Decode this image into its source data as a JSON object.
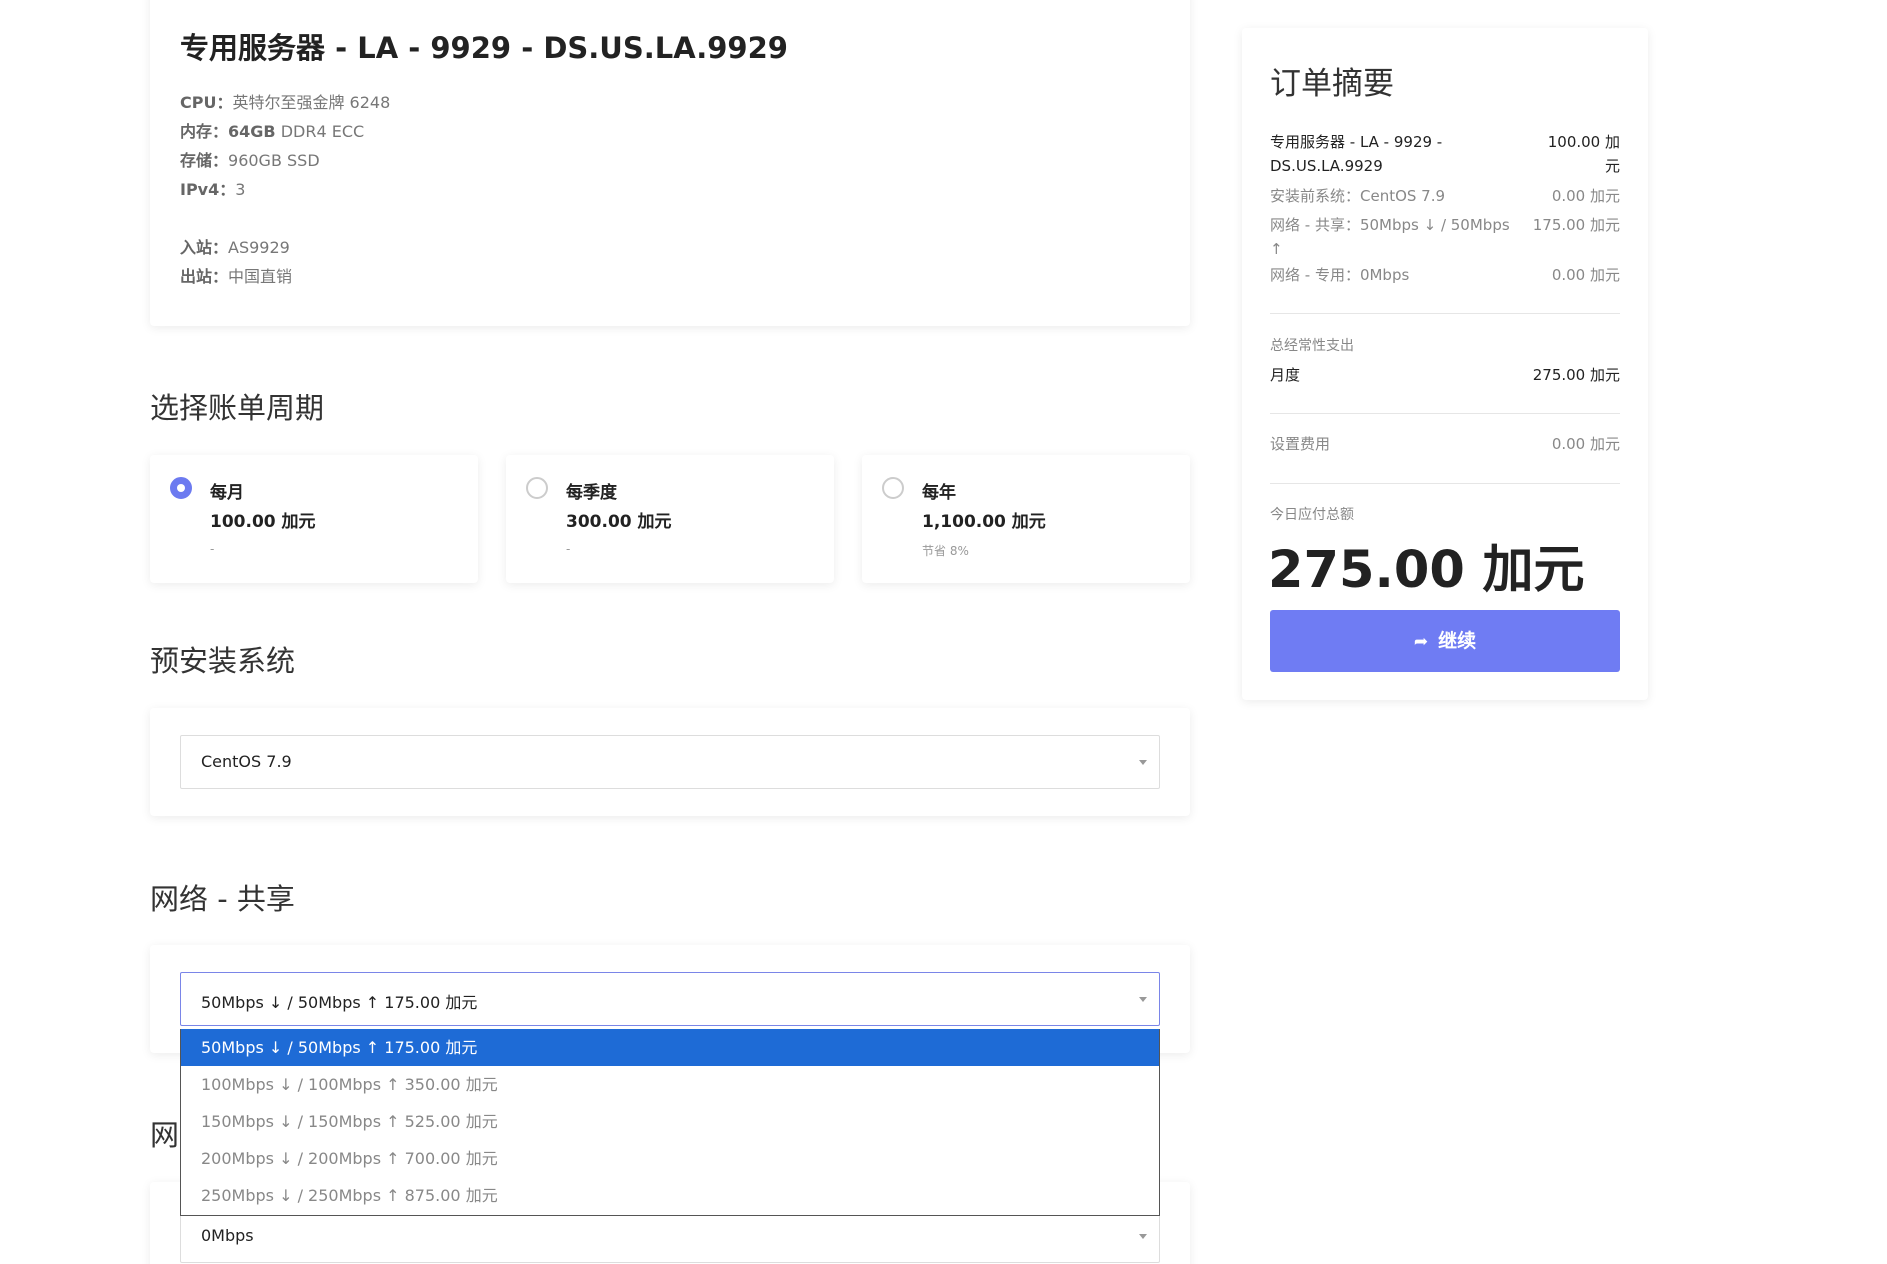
{
  "product": {
    "title": "专用服务器 - LA - 9929 - DS.US.LA.9929",
    "specs": [
      {
        "key": "CPU：",
        "value": "英特尔至强金牌 6248"
      },
      {
        "key": "内存：",
        "value_bold": "64GB",
        "value": " DDR4 ECC"
      },
      {
        "key": "存储：",
        "value": "960GB SSD"
      },
      {
        "key": "IPv4：",
        "value": "3"
      }
    ],
    "specs2": [
      {
        "key": "入站：",
        "value": "AS9929"
      },
      {
        "key": "出站：",
        "value": "中国直销"
      }
    ]
  },
  "billing": {
    "title": "选择账单周期",
    "options": [
      {
        "name": "每月",
        "price": "100.00 加元",
        "note": "-",
        "checked": true
      },
      {
        "name": "每季度",
        "price": "300.00 加元",
        "note": "-",
        "checked": false
      },
      {
        "name": "每年",
        "price": "1,100.00 加元",
        "note": "节省 8%",
        "checked": false
      }
    ]
  },
  "os": {
    "title": "预安装系统",
    "selected": "CentOS 7.9"
  },
  "network_shared": {
    "title": "网络 - 共享",
    "selected": "50Mbps ↓ / 50Mbps ↑ 175.00 加元",
    "options": [
      "50Mbps ↓ / 50Mbps ↑ 175.00 加元",
      "100Mbps ↓ / 100Mbps ↑ 350.00 加元",
      "150Mbps ↓ / 150Mbps ↑ 525.00 加元",
      "200Mbps ↓ / 200Mbps ↑ 700.00 加元",
      "250Mbps ↓ / 250Mbps ↑ 875.00 加元"
    ]
  },
  "network_dedicated": {
    "title_partial": "网",
    "selected": "0Mbps"
  },
  "summary": {
    "title": "订单摘要",
    "lines": [
      {
        "label": "专用服务器 - LA - 9929 - DS.US.LA.9929",
        "amount": "100.00 加元"
      },
      {
        "label": "安装前系统：CentOS 7.9",
        "amount": "0.00 加元"
      },
      {
        "label": "网络 - 共享：50Mbps ↓ / 50Mbps ↑",
        "amount": "175.00 加元"
      },
      {
        "label": "网络 - 专用：0Mbps",
        "amount": "0.00 加元"
      }
    ],
    "recurring_label": "总经常性支出",
    "recurring_period": "月度",
    "recurring_amount": "275.00 加元",
    "setup_label": "设置费用",
    "setup_amount": "0.00 加元",
    "due_today_label": "今日应付总额",
    "due_today": "275.00 加元",
    "continue_label": "继续"
  },
  "colors": {
    "accent": "#6f7cf3",
    "selected_option": "#1e6bd6"
  }
}
